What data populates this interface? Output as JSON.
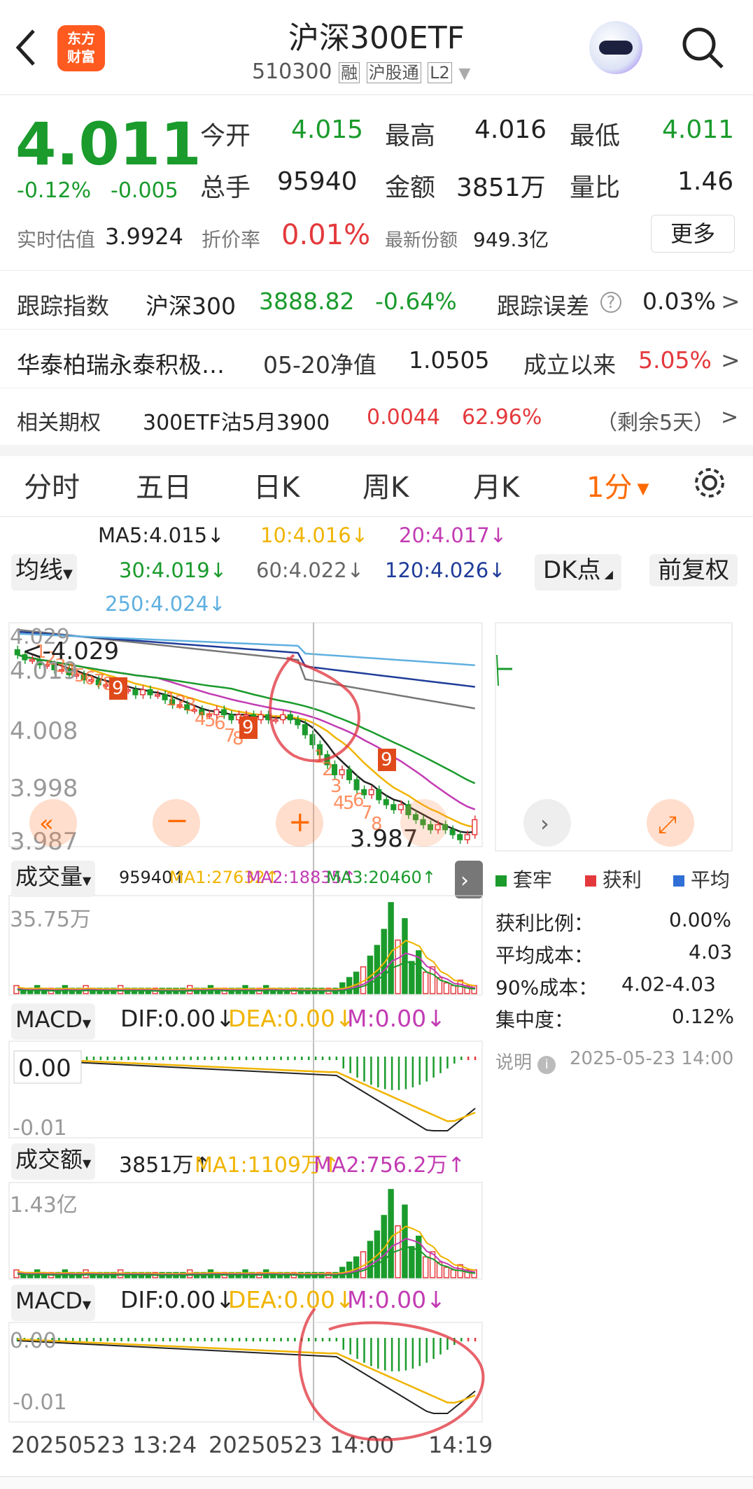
{
  "header": {
    "title": "沪深300ETF",
    "code": "510300",
    "tag_rong": "融",
    "tag_hgt": "沪股通",
    "tag_level": "L2",
    "logo_line1": "东方",
    "logo_line2": "财富"
  },
  "quote": {
    "price": "4.011",
    "pct": "-0.12%",
    "chg": "-0.005",
    "open_label": "今开",
    "open": "4.015",
    "high_label": "最高",
    "high": "4.016",
    "low_label": "最低",
    "low": "4.011",
    "vol_label": "总手",
    "vol": "95940",
    "amt_label": "金额",
    "amt": "3851万",
    "vr_label": "量比",
    "vr": "1.46",
    "iopv_label": "实时估值",
    "iopv": "3.9924",
    "disc_label": "折价率",
    "disc": "0.01%",
    "share_label": "最新份额",
    "share": "949.3亿",
    "more": "更多"
  },
  "track": {
    "label": "跟踪指数",
    "index": "沪深300",
    "value": "3888.82",
    "pct": "-0.64%",
    "err_label": "跟踪误差",
    "err": "0.03%"
  },
  "fund": {
    "name": "华泰柏瑞永泰积极…",
    "nav_label": "05-20净值",
    "nav": "1.0505",
    "since_label": "成立以来",
    "since": "5.05%"
  },
  "option": {
    "label": "相关期权",
    "name": "300ETF沽5月3900",
    "price": "0.0044",
    "pct": "62.96%",
    "remain": "（剩余5天）"
  },
  "tabs": [
    "分时",
    "五日",
    "日K",
    "周K",
    "月K",
    "1分"
  ],
  "ma": {
    "ma5": "MA5:4.015↓",
    "ma10": "10:4.016↓",
    "ma20": "20:4.017↓",
    "ma30": "30:4.019↓",
    "ma60": "60:4.022↓",
    "ma120": "120:4.026↓",
    "ma250": "250:4.024↓",
    "avg_btn": "均线",
    "dk_btn": "DK点",
    "fq_btn": "前复权"
  },
  "chart_data": {
    "type": "candlestick",
    "y_ticks": [
      "4.029",
      "4.019",
      "4.008",
      "3.998",
      "3.987"
    ],
    "y_range": [
      3.987,
      4.029
    ],
    "price_label_high": "<-4.029",
    "price_label_low": "3.987",
    "closes": [
      4.024,
      4.023,
      4.023,
      4.022,
      4.022,
      4.021,
      4.021,
      4.02,
      4.02,
      4.019,
      4.019,
      4.018,
      4.018,
      4.018,
      4.017,
      4.017,
      4.016,
      4.017,
      4.016,
      4.016,
      4.015,
      4.014,
      4.014,
      4.013,
      4.013,
      4.012,
      4.012,
      4.013,
      4.012,
      4.011,
      4.012,
      4.012,
      4.011,
      4.012,
      4.011,
      4.011,
      4.012,
      4.011,
      4.01,
      4.008,
      4.006,
      4.004,
      4.002,
      4.0,
      4.001,
      3.999,
      3.997,
      3.996,
      3.997,
      3.995,
      3.994,
      3.993,
      3.994,
      3.992,
      3.991,
      3.99,
      3.989,
      3.99,
      3.989,
      3.988,
      3.987,
      3.988,
      3.991
    ],
    "td_labels": [
      "1",
      "2",
      "3",
      "4",
      "5",
      "6",
      "7",
      "8",
      "9",
      "1",
      "2",
      "3",
      "4",
      "5",
      "6",
      "7",
      "8",
      "9",
      "1",
      "2",
      "3",
      "4",
      "5",
      "6",
      "7",
      "8",
      "9"
    ],
    "x_labels": [
      "20250523 13:24",
      "20250523 14:00",
      "14:19"
    ]
  },
  "chips": {
    "legend": [
      "套牢",
      "获利",
      "平均"
    ],
    "rows": [
      {
        "k": "获利比例：",
        "v": "0.00%"
      },
      {
        "k": "平均成本：",
        "v": "4.03"
      },
      {
        "k": "90%成本：",
        "v": "4.02-4.03"
      },
      {
        "k": "集中度：",
        "v": "0.12%"
      }
    ],
    "note": "说明",
    "date": "2025-05-23 14:00"
  },
  "vol_panel": {
    "label": "成交量",
    "v": "95940↑",
    "ma1": "MA1:27632↑",
    "ma2": "MA2:18835↑",
    "ma3": "MA3:20460↑",
    "max": "35.75万",
    "values": [
      3,
      2,
      2,
      3,
      2,
      2,
      2,
      3,
      2,
      2,
      3,
      2,
      2,
      2,
      2,
      3,
      2,
      2,
      2,
      2,
      2,
      2,
      2,
      2,
      2,
      3,
      2,
      2,
      3,
      2,
      2,
      2,
      2,
      3,
      2,
      2,
      3,
      2,
      2,
      2,
      2,
      2,
      2,
      2,
      2,
      2,
      2,
      4,
      6,
      8,
      10,
      14,
      18,
      24,
      34,
      20,
      28,
      12,
      16,
      8,
      10,
      6,
      4,
      3,
      5,
      3,
      3
    ]
  },
  "macd1": {
    "label": "MACD",
    "dif": "DIF:0.00↓",
    "dea": "DEA:0.00↓",
    "m": "M:0.00↓",
    "t1": "0.00",
    "t2": "-0.01"
  },
  "amt_panel": {
    "label": "成交额",
    "v": "3851万↑",
    "ma1": "MA1:1109万↑",
    "ma2": "MA2:756.2万↑",
    "max": "1.43亿"
  },
  "macd2": {
    "label": "MACD",
    "dif": "DIF:0.00↓",
    "dea": "DEA:0.00↓",
    "m": "M:0.00↓",
    "t1": "0.00",
    "t2": "-0.01"
  },
  "colors": {
    "up": "#e4393c",
    "down": "#1a9b2c",
    "accent": "#ff6a00"
  }
}
